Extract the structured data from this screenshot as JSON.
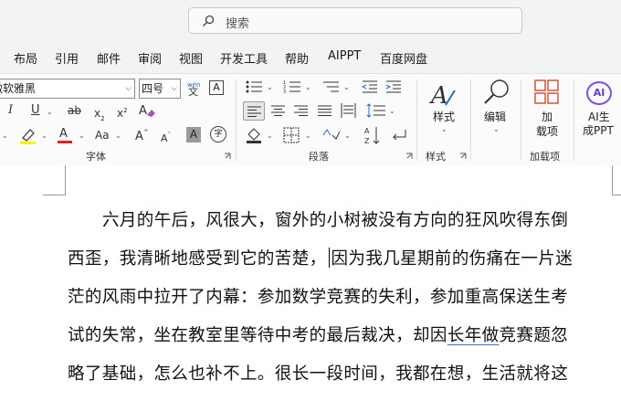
{
  "search": {
    "placeholder": "搜索"
  },
  "menu": [
    "布局",
    "引用",
    "邮件",
    "审阅",
    "视图",
    "开发工具",
    "帮助",
    "AIPPT",
    "百度网盘"
  ],
  "font": {
    "name": "微软雅黑",
    "size": "四号",
    "phonetic_top": "wén",
    "phonetic_char": "文",
    "charborder": "A",
    "italic": "I",
    "underline": "U",
    "strike": "ab",
    "subscript": "x",
    "subscript_mark": "2",
    "superscript": "x",
    "superscript_mark": "2",
    "aa": "Aa",
    "grow": "A",
    "shrink": "A",
    "shade": "A",
    "enclose": "字",
    "label": "字体",
    "font_color": "#e02020",
    "highlight_color": "#fff200"
  },
  "paragraph": {
    "label": "段落"
  },
  "styles": {
    "label": "样式",
    "button": "样式"
  },
  "editing": {
    "button": "编辑"
  },
  "addins": {
    "button_line1": "加",
    "button_line2": "载项",
    "label": "加载项"
  },
  "ai": {
    "badge": "AI",
    "line1": "AI生",
    "line2": "成PPT"
  },
  "document": {
    "lines": [
      "六月的午后，风很大，窗外的小树被没有方向的狂风吹得东倒",
      "西歪，我清晰地感受到它的苦楚，",
      "因为我几星期前的伤痛在一片迷",
      "茫的风雨中拉开了内幕：参加数学竞赛的失利，参加重高保送生考",
      "试的失常，坐在教室里等待中考的最后裁决，却因",
      "长年做",
      "竞赛题忽",
      "略了基础，怎么也补不上。很长一段时间，我都在想，生活就将这"
    ]
  }
}
